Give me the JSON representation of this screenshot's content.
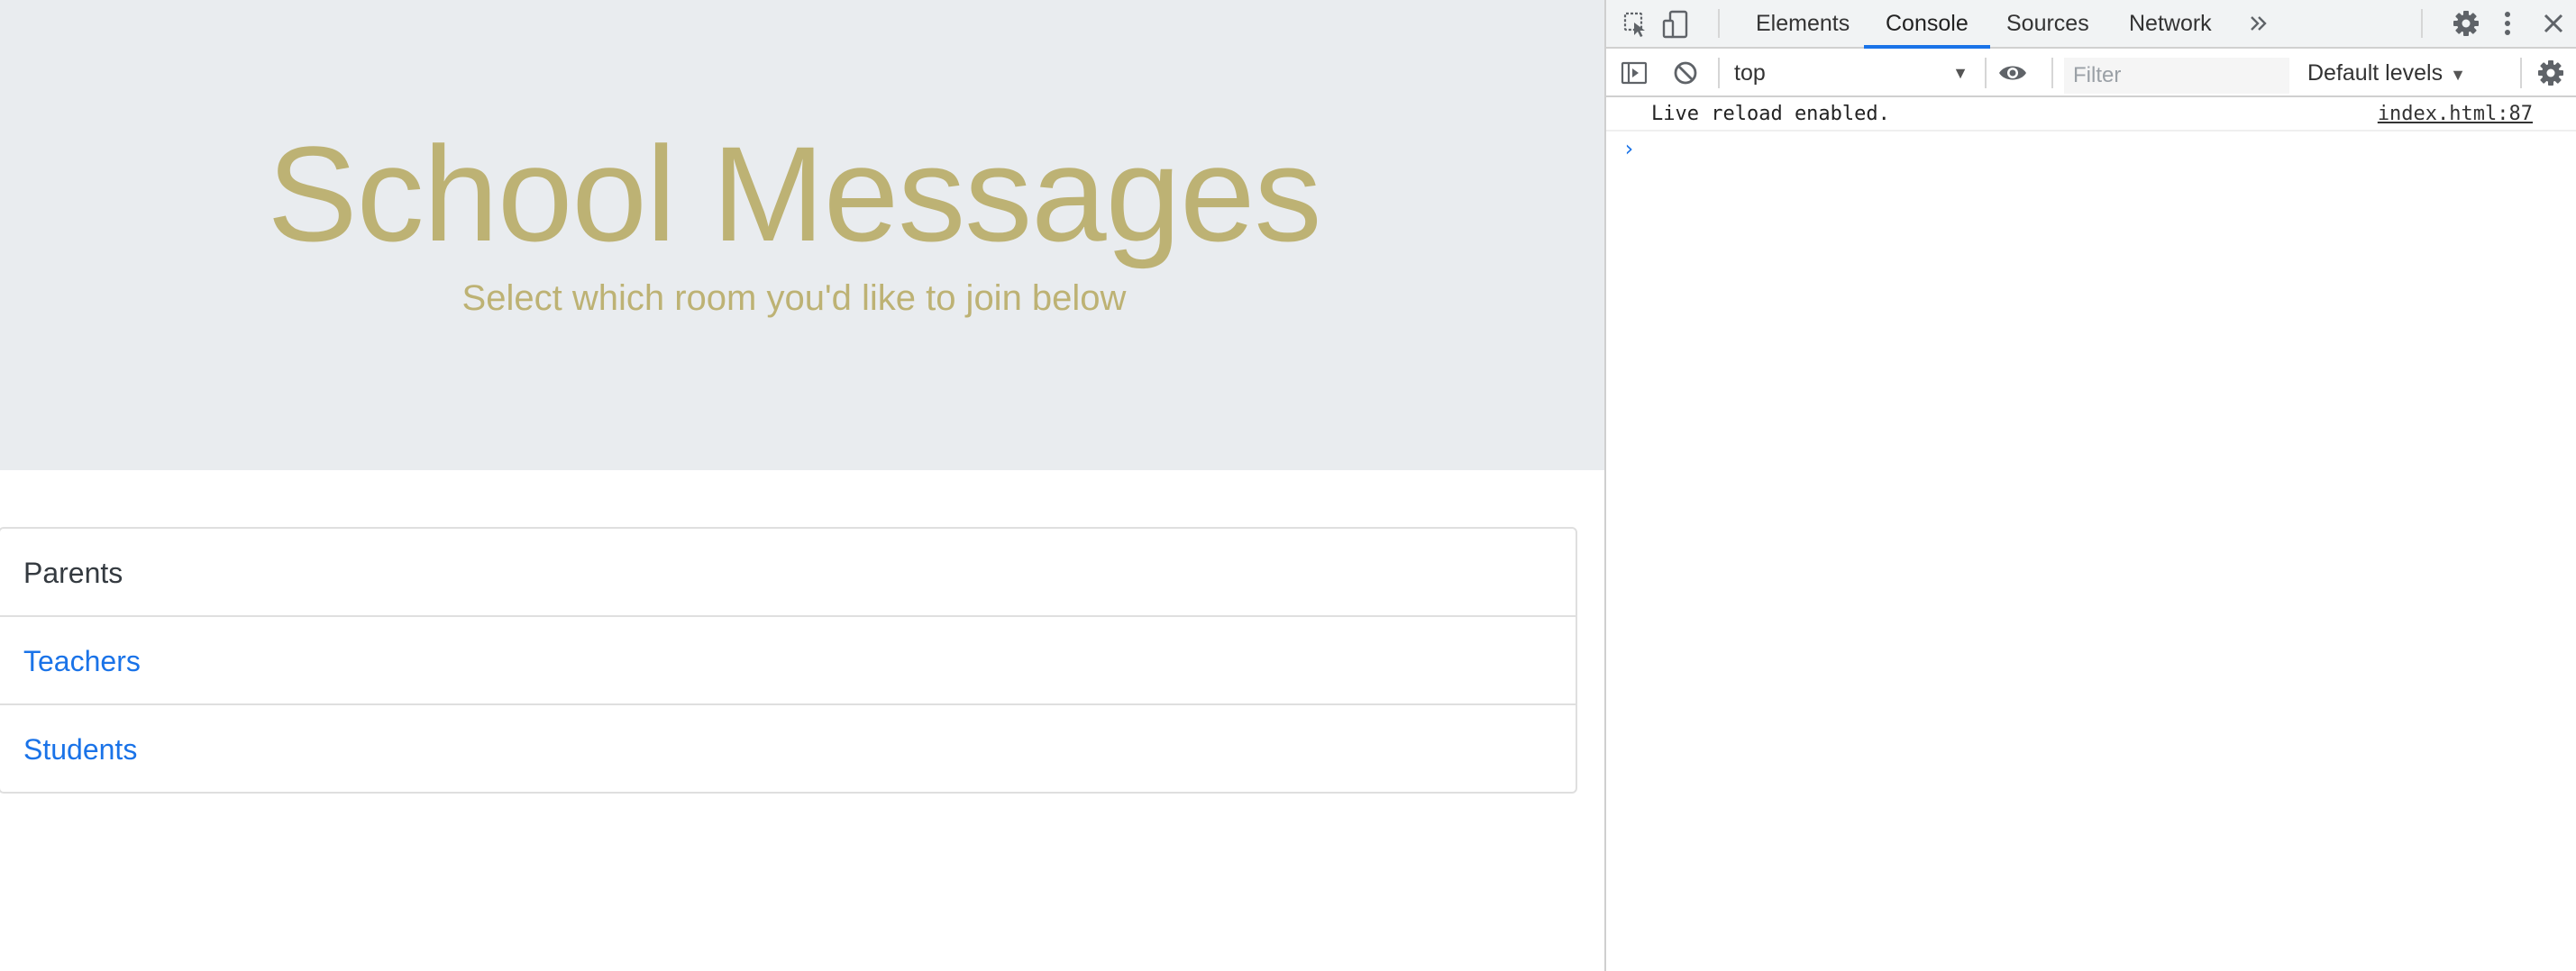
{
  "page": {
    "hero": {
      "title": "School Messages",
      "subtitle": "Select which room you'd like to join below"
    },
    "rooms": [
      {
        "label": "Parents",
        "active": true
      },
      {
        "label": "Teachers",
        "active": false
      },
      {
        "label": "Students",
        "active": false
      }
    ],
    "colors": {
      "hero_bg": "#e9ecef",
      "hero_text": "#bdb274",
      "link": "#1a73e8",
      "active_text": "#343a40"
    }
  },
  "devtools": {
    "tabs": [
      {
        "label": "Elements",
        "active": false
      },
      {
        "label": "Console",
        "active": true
      },
      {
        "label": "Sources",
        "active": false
      },
      {
        "label": "Network",
        "active": false
      }
    ],
    "more_tabs_icon": "double-chevron-right-icon",
    "toolbar": {
      "context": "top",
      "filter_placeholder": "Filter",
      "levels_label": "Default levels"
    },
    "console": {
      "messages": [
        {
          "text": "Live reload enabled.",
          "source": "index.html:87"
        }
      ],
      "prompt_symbol": "›"
    }
  }
}
